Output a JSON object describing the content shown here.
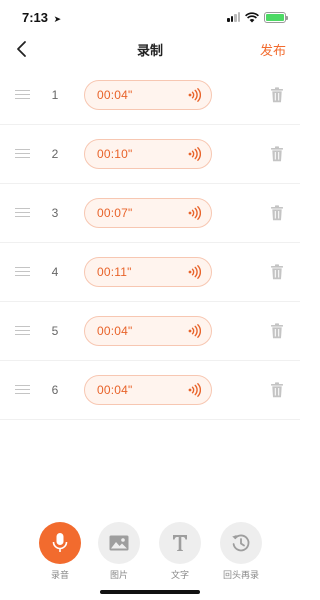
{
  "status_bar": {
    "time": "7:13",
    "location_arrow": "➤"
  },
  "nav": {
    "title": "录制",
    "publish_label": "发布"
  },
  "recordings": [
    {
      "index": "1",
      "duration": "00:04\""
    },
    {
      "index": "2",
      "duration": "00:10\""
    },
    {
      "index": "3",
      "duration": "00:07\""
    },
    {
      "index": "4",
      "duration": "00:11\""
    },
    {
      "index": "5",
      "duration": "00:04\""
    },
    {
      "index": "6",
      "duration": "00:04\""
    }
  ],
  "toolbar": [
    {
      "label": "录音",
      "icon": "microphone-icon",
      "active": true
    },
    {
      "label": "图片",
      "icon": "image-icon",
      "active": false
    },
    {
      "label": "文字",
      "icon": "text-icon",
      "active": false
    },
    {
      "label": "回头再录",
      "icon": "history-icon",
      "active": false
    }
  ],
  "colors": {
    "accent": "#f26b2e",
    "clip_bg": "#fff4ee",
    "clip_border": "#f7c7b2"
  }
}
